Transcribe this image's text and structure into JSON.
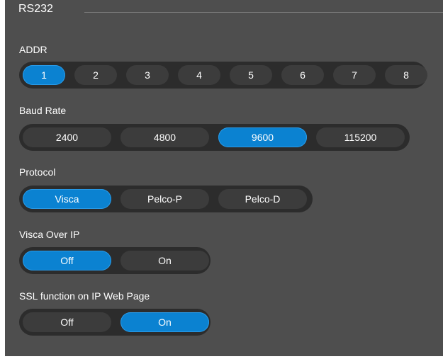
{
  "section": {
    "title": "RS232"
  },
  "addr": {
    "label": "ADDR",
    "options": [
      "1",
      "2",
      "3",
      "4",
      "5",
      "6",
      "7",
      "8"
    ],
    "selected": "1"
  },
  "baud_rate": {
    "label": "Baud Rate",
    "options": [
      "2400",
      "4800",
      "9600",
      "115200"
    ],
    "selected": "9600"
  },
  "protocol": {
    "label": "Protocol",
    "options": [
      "Visca",
      "Pelco-P",
      "Pelco-D"
    ],
    "selected": "Visca"
  },
  "visca_over_ip": {
    "label": "Visca Over IP",
    "options": [
      "Off",
      "On"
    ],
    "selected": "Off"
  },
  "ssl_function": {
    "label": "SSL function on IP Web Page",
    "options": [
      "Off",
      "On"
    ],
    "selected": "On"
  },
  "colors": {
    "panel_background": "#4e4e4e",
    "group_background": "#2c2c2c",
    "option_background": "#3c3c3c",
    "selected_accent": "#0b82d1",
    "text": "#ffffff"
  }
}
